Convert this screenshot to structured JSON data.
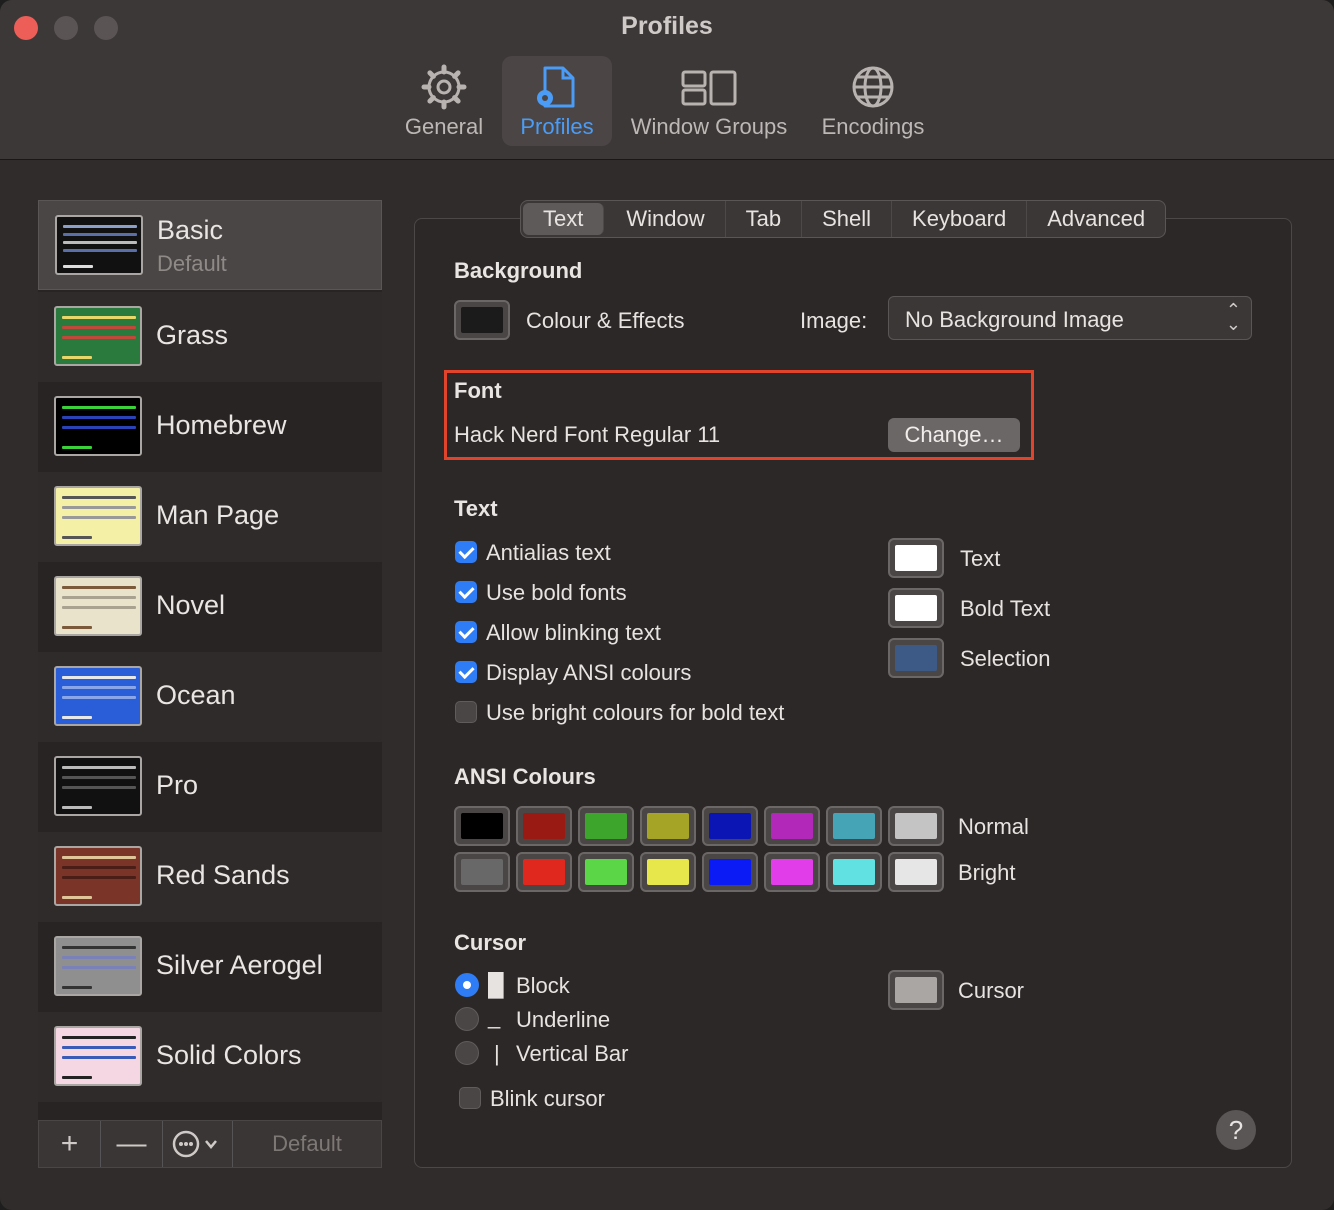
{
  "window": {
    "title": "Profiles"
  },
  "toolbar": {
    "items": [
      {
        "label": "General",
        "icon": "gear-icon"
      },
      {
        "label": "Profiles",
        "icon": "profiles-icon"
      },
      {
        "label": "Window Groups",
        "icon": "window-groups-icon"
      },
      {
        "label": "Encodings",
        "icon": "globe-icon"
      }
    ],
    "active": "Profiles"
  },
  "sidebar": {
    "profiles": [
      {
        "name": "Basic",
        "subtitle": "Default"
      },
      {
        "name": "Grass"
      },
      {
        "name": "Homebrew"
      },
      {
        "name": "Man Page"
      },
      {
        "name": "Novel"
      },
      {
        "name": "Ocean"
      },
      {
        "name": "Pro"
      },
      {
        "name": "Red Sands"
      },
      {
        "name": "Silver Aerogel"
      },
      {
        "name": "Solid Colors"
      }
    ],
    "selected": "Basic",
    "buttons": {
      "add": "+",
      "remove": "—",
      "default_label": "Default"
    }
  },
  "tabs": [
    "Text",
    "Window",
    "Tab",
    "Shell",
    "Keyboard",
    "Advanced"
  ],
  "active_tab": "Text",
  "background": {
    "title": "Background",
    "colour_effects_label": "Colour & Effects",
    "image_label": "Image:",
    "image_value": "No Background Image"
  },
  "font": {
    "title": "Font",
    "value": "Hack Nerd Font Regular 11",
    "change_button": "Change…"
  },
  "text": {
    "title": "Text",
    "options": [
      {
        "label": "Antialias text",
        "checked": true
      },
      {
        "label": "Use bold fonts",
        "checked": true
      },
      {
        "label": "Allow blinking text",
        "checked": true
      },
      {
        "label": "Display ANSI colours",
        "checked": true
      },
      {
        "label": "Use bright colours for bold text",
        "checked": false
      }
    ],
    "colours": [
      {
        "label": "Text",
        "color": "#ffffff"
      },
      {
        "label": "Bold Text",
        "color": "#ffffff"
      },
      {
        "label": "Selection",
        "color": "#3d5a86"
      }
    ]
  },
  "ansi": {
    "title": "ANSI Colours",
    "normal_label": "Normal",
    "bright_label": "Bright",
    "normal": [
      "#000000",
      "#991a13",
      "#3ea52c",
      "#a6a427",
      "#0a15b3",
      "#b228b8",
      "#45a4b6",
      "#c5c4c4"
    ],
    "bright": [
      "#686868",
      "#e1281f",
      "#5bd646",
      "#e7e64a",
      "#0a1bf5",
      "#e13de8",
      "#62e1e3",
      "#e6e6e6"
    ]
  },
  "cursor": {
    "title": "Cursor",
    "options": [
      {
        "label": "Block",
        "glyph": "█",
        "selected": true
      },
      {
        "label": "Underline",
        "glyph": "_",
        "selected": false
      },
      {
        "label": "Vertical Bar",
        "glyph": "|",
        "selected": false
      }
    ],
    "blink_label": "Blink cursor",
    "blink_checked": false,
    "colour_label": "Cursor",
    "colour": "#a9a6a4"
  },
  "help_glyph": "?"
}
